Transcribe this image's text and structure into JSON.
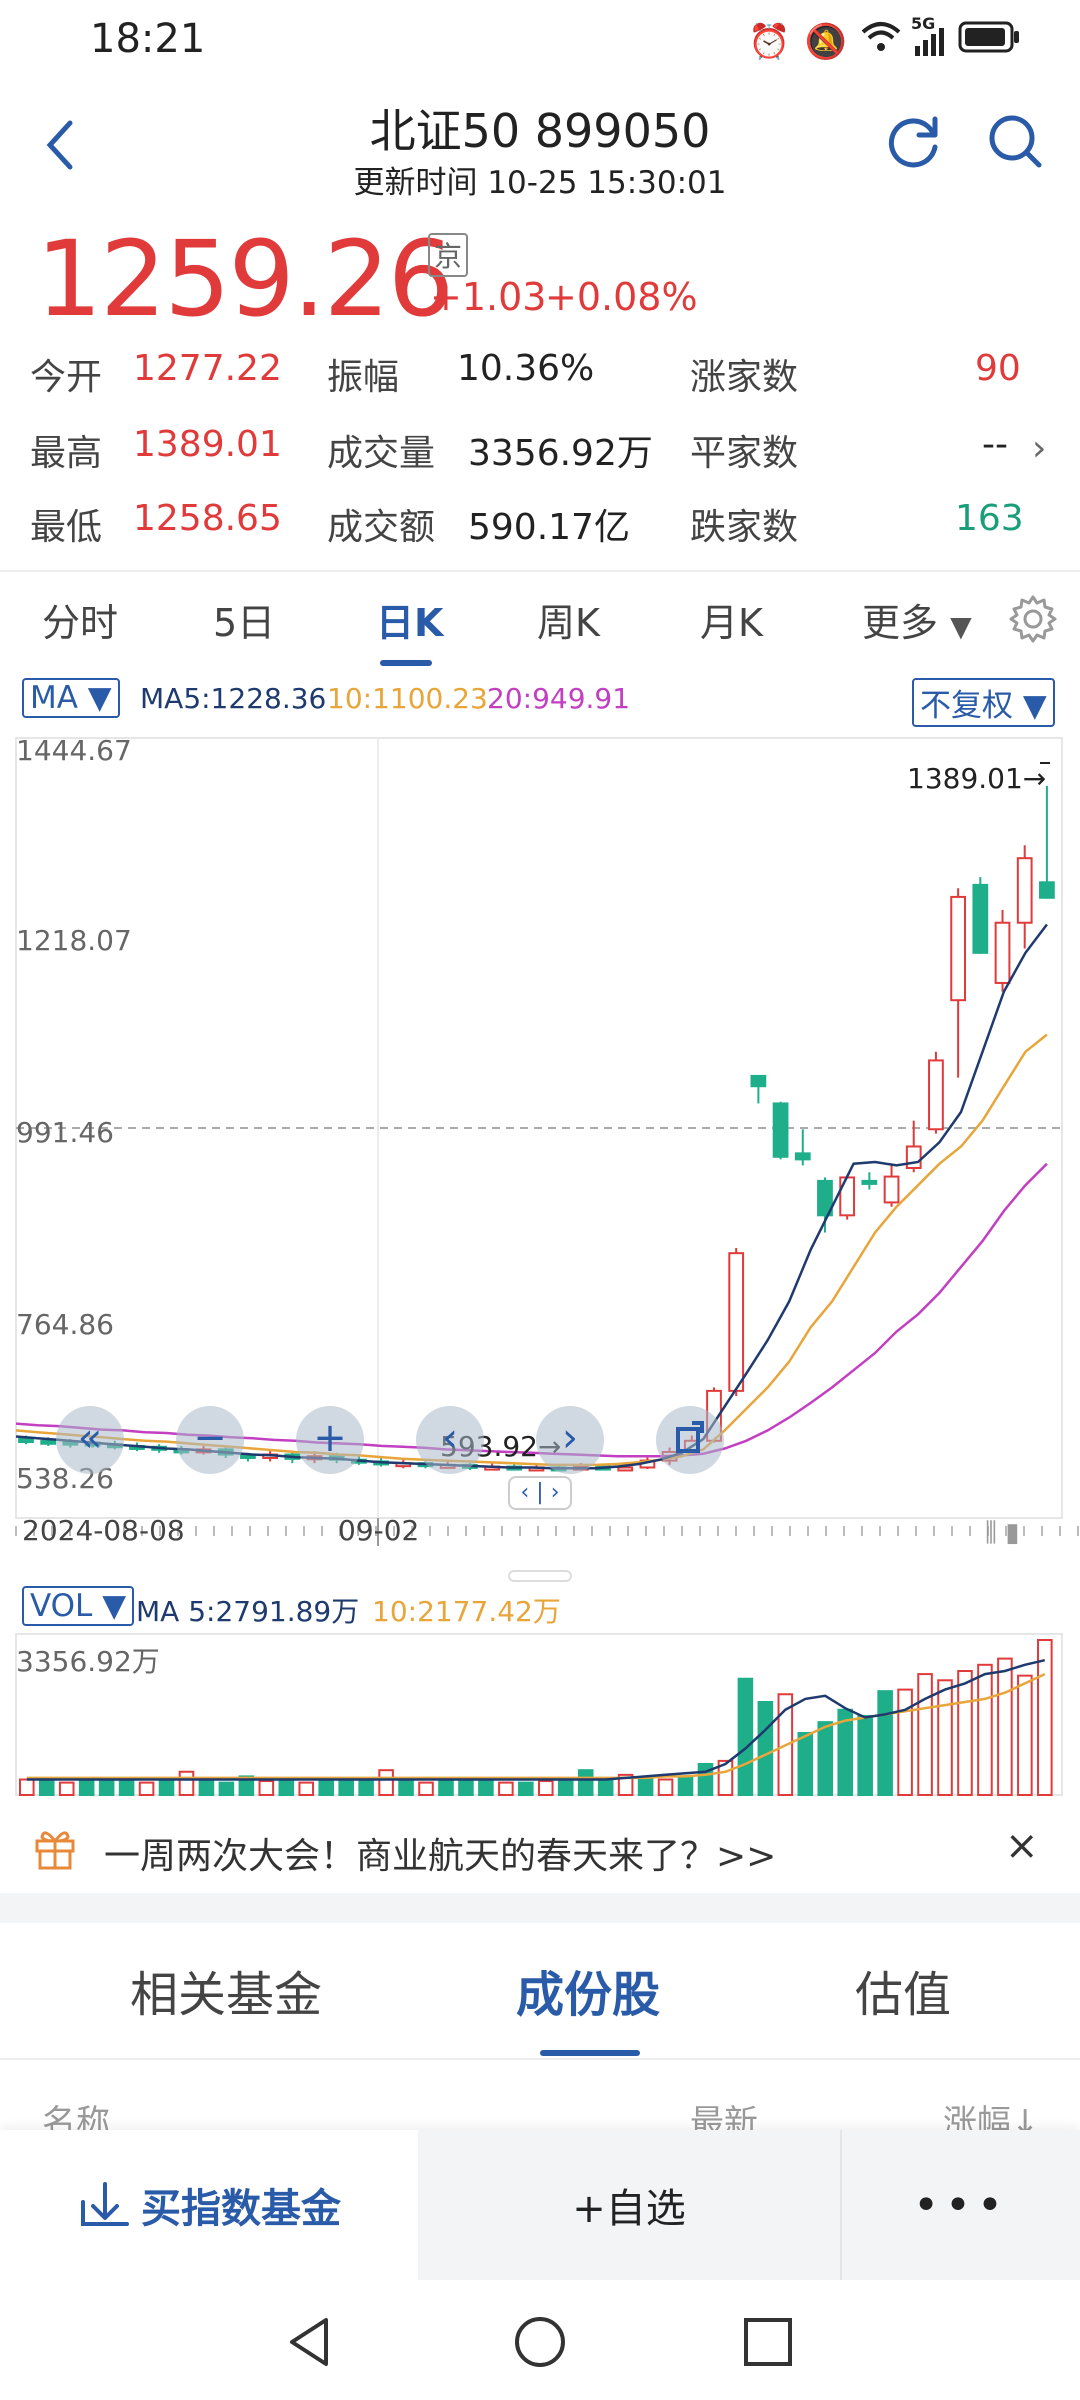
{
  "status_bar": {
    "time": "18:21",
    "network": "5G"
  },
  "header": {
    "title": "北证50 899050",
    "update_time": "更新时间 10-25 15:30:01"
  },
  "quote": {
    "price": "1259.26",
    "exchange_badge": "京",
    "change": "+1.03",
    "change_pct": "+0.08%",
    "stats": [
      {
        "label": "今开",
        "value": "1277.22"
      },
      {
        "label": "振幅",
        "value": "10.36%"
      },
      {
        "label": "涨家数",
        "value": "90"
      },
      {
        "label": "最高",
        "value": "1389.01"
      },
      {
        "label": "成交量",
        "value": "3356.92万"
      },
      {
        "label": "平家数",
        "value": "--"
      },
      {
        "label": "最低",
        "value": "1258.65"
      },
      {
        "label": "成交额",
        "value": "590.17亿"
      },
      {
        "label": "跌家数",
        "value": "163"
      }
    ]
  },
  "period_tabs": [
    "分时",
    "5日",
    "日K",
    "周K",
    "月K",
    "更多"
  ],
  "chart": {
    "indicator_button": "MA",
    "ma_values": [
      "MA5:1228.36",
      "10:1100.23",
      "20:949.91"
    ],
    "adjust_button": "不复权",
    "y_labels": [
      "1444.67",
      "1218.07",
      "991.46",
      "764.86",
      "538.26"
    ],
    "max_marker": "1389.01→",
    "min_marker": "593.92→",
    "x_labels": [
      "2024-08-08",
      "09-02"
    ],
    "colors": {
      "up": "#e03a3a",
      "down": "#1fae8a",
      "ma5": "#1e3a6e",
      "ma10": "#e8a53a",
      "ma20": "#c23fc2"
    },
    "zoom_controls": [
      "«",
      "−",
      "+",
      "‹",
      "›"
    ],
    "scroll_label": "‹ | ›"
  },
  "chart_data": {
    "type": "candlestick",
    "ylim": [
      538.26,
      1444.67
    ],
    "candles": [
      {
        "o": 630,
        "c": 628,
        "h": 634,
        "l": 624
      },
      {
        "o": 628,
        "c": 627,
        "h": 632,
        "l": 622
      },
      {
        "o": 627,
        "c": 626,
        "h": 630,
        "l": 620
      },
      {
        "o": 626,
        "c": 624,
        "h": 630,
        "l": 620
      },
      {
        "o": 624,
        "c": 622,
        "h": 628,
        "l": 618
      },
      {
        "o": 622,
        "c": 621,
        "h": 626,
        "l": 616
      },
      {
        "o": 621,
        "c": 618,
        "h": 624,
        "l": 614
      },
      {
        "o": 618,
        "c": 616,
        "h": 622,
        "l": 612
      },
      {
        "o": 616,
        "c": 618,
        "h": 622,
        "l": 612
      },
      {
        "o": 618,
        "c": 612,
        "h": 620,
        "l": 608
      },
      {
        "o": 612,
        "c": 608,
        "h": 614,
        "l": 604
      },
      {
        "o": 608,
        "c": 612,
        "h": 616,
        "l": 604
      },
      {
        "o": 612,
        "c": 607,
        "h": 614,
        "l": 602
      },
      {
        "o": 607,
        "c": 610,
        "h": 616,
        "l": 602
      },
      {
        "o": 610,
        "c": 606,
        "h": 614,
        "l": 602
      },
      {
        "o": 606,
        "c": 604,
        "h": 610,
        "l": 600
      },
      {
        "o": 604,
        "c": 601,
        "h": 608,
        "l": 598
      },
      {
        "o": 601,
        "c": 602,
        "h": 606,
        "l": 596
      },
      {
        "o": 602,
        "c": 599,
        "h": 604,
        "l": 596
      },
      {
        "o": 599,
        "c": 600,
        "h": 604,
        "l": 596
      },
      {
        "o": 600,
        "c": 597,
        "h": 602,
        "l": 594
      },
      {
        "o": 597,
        "c": 598,
        "h": 602,
        "l": 594
      },
      {
        "o": 598,
        "c": 596,
        "h": 601,
        "l": 594
      },
      {
        "o": 596,
        "c": 597,
        "h": 601,
        "l": 594
      },
      {
        "o": 597,
        "c": 596,
        "h": 601,
        "l": 594
      },
      {
        "o": 596,
        "c": 598,
        "h": 602,
        "l": 594
      },
      {
        "o": 598,
        "c": 596,
        "h": 601,
        "l": 594
      },
      {
        "o": 596,
        "c": 597,
        "h": 600,
        "l": 594
      },
      {
        "o": 597,
        "c": 605,
        "h": 610,
        "l": 595
      },
      {
        "o": 605,
        "c": 615,
        "h": 620,
        "l": 600
      },
      {
        "o": 615,
        "c": 628,
        "h": 634,
        "l": 612
      },
      {
        "o": 628,
        "c": 686,
        "h": 690,
        "l": 626
      },
      {
        "o": 686,
        "c": 846,
        "h": 852,
        "l": 680
      },
      {
        "o": 1052,
        "c": 1040,
        "h": 1052,
        "l": 1020
      },
      {
        "o": 1020,
        "c": 958,
        "h": 1022,
        "l": 955
      },
      {
        "o": 962,
        "c": 955,
        "h": 990,
        "l": 948
      },
      {
        "o": 930,
        "c": 890,
        "h": 934,
        "l": 870
      },
      {
        "o": 890,
        "c": 934,
        "h": 936,
        "l": 885
      },
      {
        "o": 930,
        "c": 928,
        "h": 940,
        "l": 920
      },
      {
        "o": 905,
        "c": 935,
        "h": 950,
        "l": 900
      },
      {
        "o": 945,
        "c": 970,
        "h": 1000,
        "l": 940
      },
      {
        "o": 990,
        "c": 1070,
        "h": 1080,
        "l": 985
      },
      {
        "o": 1140,
        "c": 1260,
        "h": 1270,
        "l": 1050
      },
      {
        "o": 1274,
        "c": 1195,
        "h": 1283,
        "l": 1194
      },
      {
        "o": 1160,
        "c": 1230,
        "h": 1245,
        "l": 1150
      },
      {
        "o": 1230,
        "c": 1305,
        "h": 1320,
        "l": 1200
      },
      {
        "o": 1277,
        "c": 1259,
        "h": 1389,
        "l": 1258
      }
    ],
    "ma5": [
      633,
      631,
      629,
      627,
      625,
      623,
      621,
      619,
      618,
      616,
      614,
      612,
      611,
      609,
      608,
      607,
      605,
      603,
      602,
      601,
      600,
      599,
      598,
      597,
      597,
      596,
      596,
      596,
      598,
      601,
      606,
      614,
      630,
      668,
      706,
      745,
      790,
      850,
      900,
      950,
      952,
      948,
      952,
      975,
      1010,
      1080,
      1150,
      1195,
      1228
    ],
    "ma10": [
      640,
      638,
      636,
      634,
      632,
      630,
      628,
      627,
      625,
      623,
      621,
      619,
      617,
      615,
      614,
      612,
      611,
      609,
      607,
      606,
      605,
      604,
      603,
      602,
      601,
      600,
      600,
      600,
      601,
      603,
      606,
      610,
      618,
      640,
      665,
      690,
      720,
      760,
      790,
      830,
      870,
      900,
      925,
      950,
      970,
      1000,
      1040,
      1080,
      1100
    ],
    "ma20": [
      648,
      646,
      645,
      643,
      641,
      640,
      638,
      637,
      635,
      634,
      632,
      631,
      629,
      628,
      626,
      625,
      624,
      622,
      621,
      620,
      618,
      617,
      616,
      615,
      614,
      613,
      612,
      611,
      610,
      610,
      610,
      611,
      613,
      619,
      628,
      640,
      655,
      672,
      690,
      710,
      730,
      755,
      775,
      800,
      830,
      860,
      895,
      925,
      950
    ]
  },
  "volume": {
    "indicator_button": "VOL",
    "ma5": "MA 5:2791.89万",
    "ma10": "10:2177.42万",
    "max_label": "3356.92万",
    "bars": [
      0.1,
      0.09,
      0.08,
      0.09,
      0.09,
      0.09,
      0.08,
      0.1,
      0.15,
      0.09,
      0.08,
      0.12,
      0.09,
      0.1,
      0.08,
      0.09,
      0.09,
      0.1,
      0.16,
      0.09,
      0.08,
      0.1,
      0.09,
      0.09,
      0.08,
      0.08,
      0.09,
      0.09,
      0.16,
      0.1,
      0.13,
      0.11,
      0.1,
      0.12,
      0.2,
      0.22,
      0.75,
      0.6,
      0.65,
      0.4,
      0.47,
      0.55,
      0.51,
      0.67,
      0.68,
      0.78,
      0.74,
      0.8,
      0.84,
      0.88,
      0.77,
      1.0
    ],
    "ma_line1": [
      0.1,
      0.1,
      0.1,
      0.1,
      0.1,
      0.1,
      0.1,
      0.1,
      0.1,
      0.1,
      0.1,
      0.1,
      0.1,
      0.1,
      0.1,
      0.1,
      0.1,
      0.1,
      0.1,
      0.1,
      0.1,
      0.1,
      0.1,
      0.1,
      0.1,
      0.1,
      0.1,
      0.1,
      0.1,
      0.1,
      0.11,
      0.12,
      0.13,
      0.14,
      0.15,
      0.2,
      0.3,
      0.42,
      0.55,
      0.62,
      0.64,
      0.56,
      0.5,
      0.52,
      0.55,
      0.62,
      0.68,
      0.72,
      0.78,
      0.8,
      0.84,
      0.87
    ],
    "ma_line2": [
      0.11,
      0.11,
      0.11,
      0.11,
      0.11,
      0.11,
      0.11,
      0.11,
      0.11,
      0.11,
      0.11,
      0.11,
      0.11,
      0.11,
      0.11,
      0.11,
      0.11,
      0.11,
      0.11,
      0.11,
      0.11,
      0.11,
      0.11,
      0.11,
      0.11,
      0.11,
      0.11,
      0.11,
      0.11,
      0.11,
      0.11,
      0.11,
      0.12,
      0.12,
      0.13,
      0.15,
      0.2,
      0.26,
      0.32,
      0.38,
      0.44,
      0.48,
      0.5,
      0.52,
      0.54,
      0.56,
      0.58,
      0.6,
      0.62,
      0.66,
      0.72,
      0.78
    ]
  },
  "promo": {
    "text": "一周两次大会！商业航天的春天来了？>>",
    "close": "×"
  },
  "bottom_tabs": [
    "相关基金",
    "成份股",
    "估值"
  ],
  "table_headers": [
    "名称",
    "最新",
    "涨幅↓"
  ],
  "actions": {
    "buy": "买指数基金",
    "watch": "+自选",
    "more": "•••"
  }
}
